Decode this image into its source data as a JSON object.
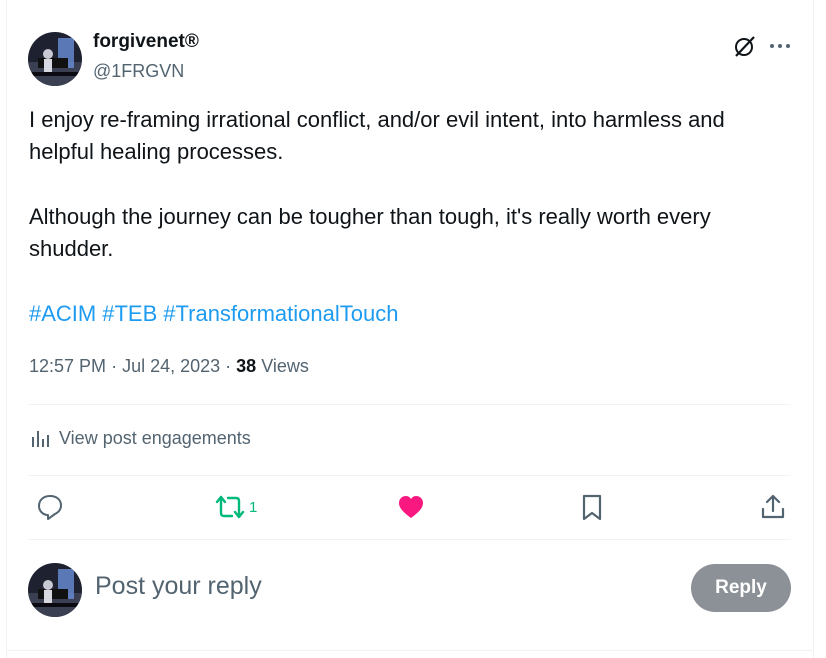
{
  "author": {
    "display_name": "forgivenet®",
    "handle": "@1FRGVN"
  },
  "post": {
    "paragraph1_line1": "I enjoy re-framing irrational conflict, and/or evil intent, into harmless and",
    "paragraph1_line2": "helpful healing processes.",
    "paragraph2_line1": "Although the journey can be tougher than tough, it's really worth every",
    "paragraph2_line2": "shudder.",
    "hashtags": [
      "#ACIM",
      "#TEB",
      "#TransformationalTouch"
    ],
    "time": "12:57 PM",
    "date": "Jul 24, 2023",
    "views_count": "38",
    "views_label": "Views"
  },
  "engagements_link": "View post engagements",
  "actions": {
    "repost_count": "1"
  },
  "reply_box": {
    "placeholder": "Post your reply",
    "button_label": "Reply"
  },
  "colors": {
    "link": "#1d9bf0",
    "repost": "#00ba7c",
    "like": "#f91880",
    "muted": "#536471"
  }
}
